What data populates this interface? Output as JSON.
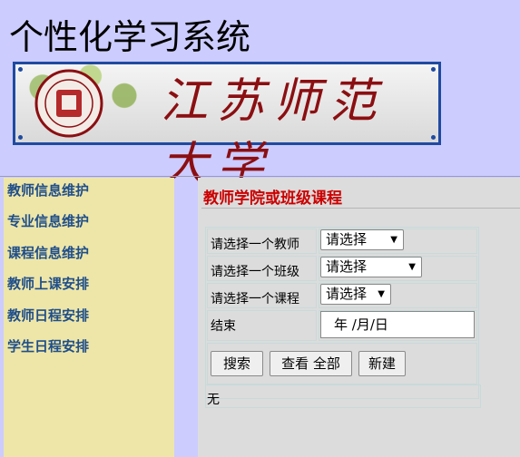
{
  "header": {
    "app_title": "个性化学习系统",
    "banner_text": "江苏师范大学"
  },
  "sidebar": {
    "items": [
      {
        "label": "教师信息维护"
      },
      {
        "label": "专业信息维护"
      },
      {
        "label": "课程信息维护"
      },
      {
        "label": "教师上课安排"
      },
      {
        "label": "教师日程安排"
      },
      {
        "label": "学生日程安排"
      }
    ]
  },
  "main": {
    "heading": "教师学院或班级课程",
    "form": {
      "teacher_label": "请选择一个教师",
      "teacher_value": "请选择",
      "class_label": "请选择一个班级",
      "class_value": "请选择",
      "course_label": "请选择一个课程",
      "course_value": "请选择",
      "end_label": "结束",
      "end_value": "年 /月/日"
    },
    "buttons": {
      "search": "搜索",
      "view_all": "查看 全部",
      "new": "新建"
    },
    "result_text": "无"
  },
  "colors": {
    "background": "#ccccff",
    "sidebar_bg": "#eee6a8",
    "sidebar_link": "#1f4e8a",
    "heading": "#cc0000",
    "banner_text": "#8b0f12",
    "banner_border": "#1f4aa0"
  }
}
